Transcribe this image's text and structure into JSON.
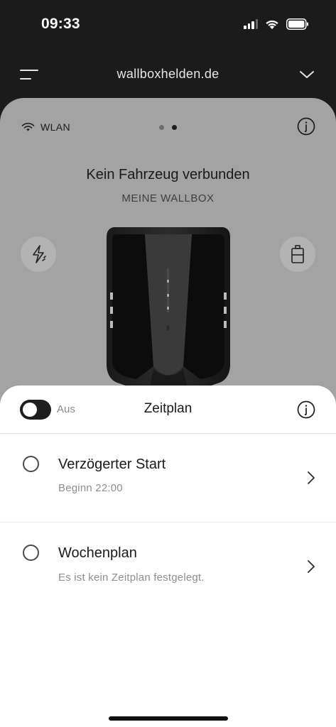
{
  "status_bar": {
    "time": "09:33"
  },
  "topnav": {
    "title": "wallboxhelden.de"
  },
  "card": {
    "connection_label": "WLAN",
    "title": "Kein Fahrzeug verbunden",
    "subtitle": "MEINE WALLBOX"
  },
  "sheet": {
    "toggle_label": "Aus",
    "title": "Zeitplan",
    "items": [
      {
        "title": "Verzögerter Start",
        "subtitle": "Beginn 22:00"
      },
      {
        "title": "Wochenplan",
        "subtitle": "Es ist kein Zeitplan festgelegt."
      }
    ]
  },
  "icons": [
    "menu-icon",
    "chevron-down-icon",
    "wifi-icon",
    "info-icon",
    "lightning-icon",
    "battery-icon",
    "chevron-right-icon"
  ]
}
